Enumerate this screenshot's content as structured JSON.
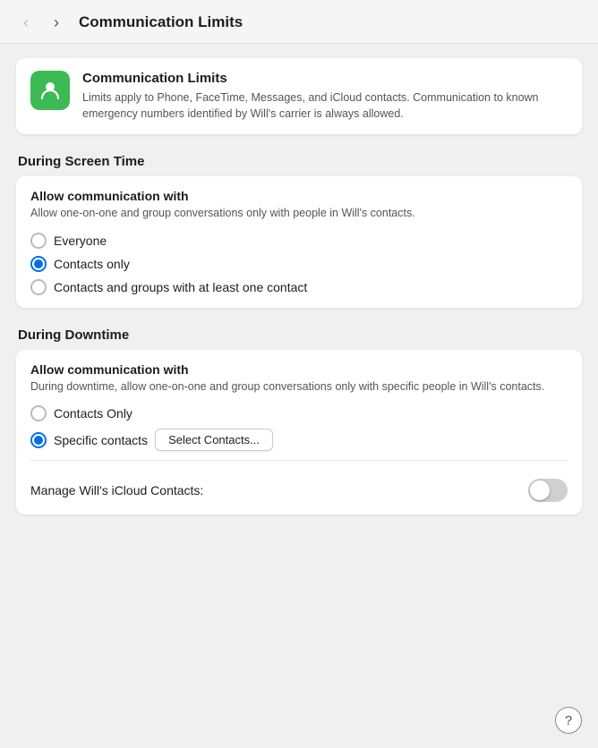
{
  "nav": {
    "back_label": "‹",
    "forward_label": "›",
    "title": "Communication Limits"
  },
  "app_header": {
    "icon_alt": "Communication Limits icon",
    "title": "Communication Limits",
    "description": "Limits apply to Phone, FaceTime, Messages, and iCloud contacts. Communication to known emergency numbers identified by Will's carrier is always allowed."
  },
  "screen_time_section": {
    "heading": "During Screen Time",
    "card_title": "Allow communication with",
    "card_subtitle": "Allow one-on-one and group conversations only with people in Will's contacts.",
    "options": [
      {
        "label": "Everyone",
        "selected": false
      },
      {
        "label": "Contacts only",
        "selected": true
      },
      {
        "label": "Contacts and groups with at least one contact",
        "selected": false
      }
    ]
  },
  "downtime_section": {
    "heading": "During Downtime",
    "card_title": "Allow communication with",
    "card_subtitle": "During downtime, allow one-on-one and group conversations only with specific people in Will's contacts.",
    "options": [
      {
        "label": "Contacts Only",
        "selected": false
      },
      {
        "label": "Specific contacts",
        "selected": true
      }
    ],
    "select_contacts_btn": "Select Contacts...",
    "manage_label": "Manage Will's iCloud Contacts:",
    "toggle_on": false
  },
  "help": {
    "label": "?"
  }
}
